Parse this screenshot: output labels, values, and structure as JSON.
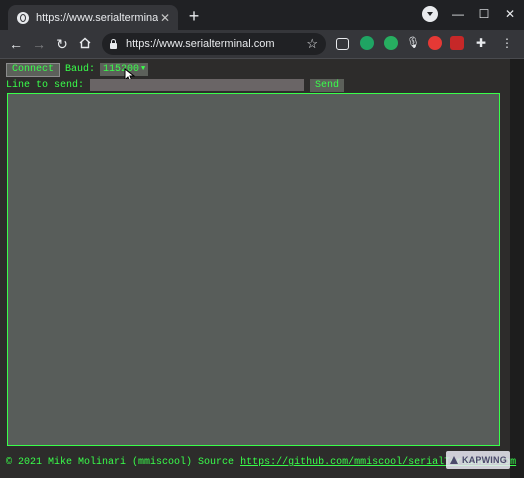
{
  "browser": {
    "tab_title": "https://www.serialterminal.com",
    "tab_close_glyph": "✕",
    "new_tab_glyph": "+",
    "window_controls": {
      "minimize": "—",
      "maximize": "☐",
      "close": "✕"
    },
    "url": "https://www.serialterminal.com",
    "extensions": [
      "tab-icon",
      "chat-icon",
      "translate-icon",
      "mic-icon",
      "record-icon",
      "bookmark-icon",
      "puzzle-icon"
    ]
  },
  "app": {
    "connect_label": "Connect",
    "baud_label": "Baud:",
    "baud_value": "115200",
    "line_label": "Line to send:",
    "line_value": "",
    "send_label": "Send",
    "terminal_output": "",
    "footer_text": "© 2021 Mike Molinari (mmiscool) Source",
    "footer_link": "https://github.com/mmiscool/serialTerminal.com",
    "accent_color": "#39ff4a",
    "watermark": "KAPWING"
  }
}
